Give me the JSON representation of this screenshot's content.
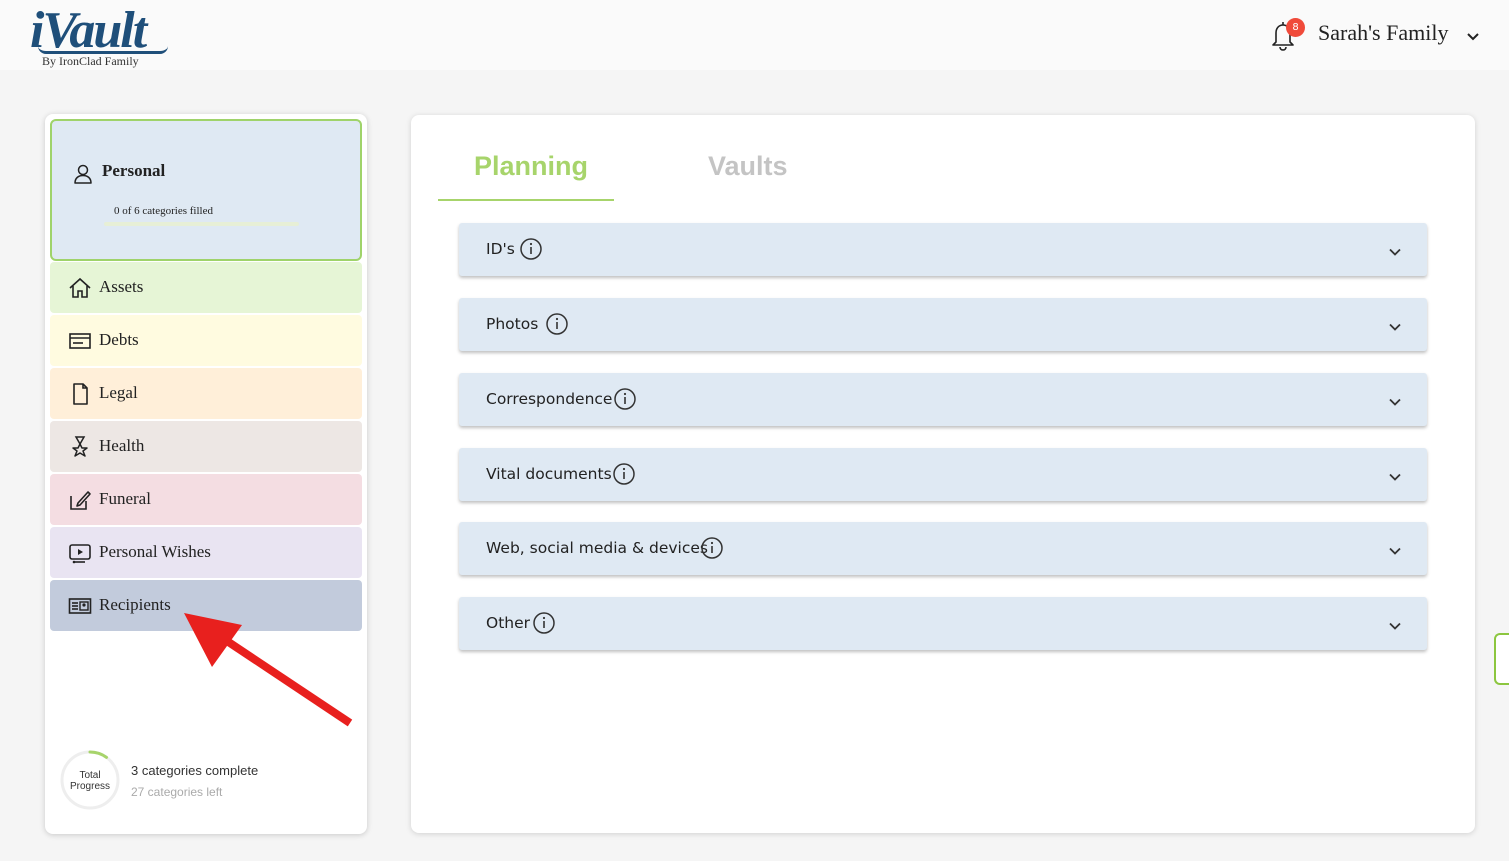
{
  "header": {
    "logo_main": "iVault",
    "logo_sub": "By IronClad Family",
    "notification_count": "8",
    "family_name": "Sarah's Family"
  },
  "sidebar": {
    "personal": {
      "title": "Personal",
      "subtitle": "0 of 6 categories filled",
      "progress": 0
    },
    "items": [
      {
        "label": "Assets",
        "icon": "home-icon",
        "color": "#e6f5d6"
      },
      {
        "label": "Debts",
        "icon": "credit-card-icon",
        "color": "#fffbe0"
      },
      {
        "label": "Legal",
        "icon": "document-icon",
        "color": "#ffefd9"
      },
      {
        "label": "Health",
        "icon": "health-ribbon-icon",
        "color": "#ede7e4"
      },
      {
        "label": "Funeral",
        "icon": "pen-square-icon",
        "color": "#f4dde2"
      },
      {
        "label": "Personal Wishes",
        "icon": "video-icon",
        "color": "#e9e4f2"
      },
      {
        "label": "Recipients",
        "icon": "id-card-icon",
        "color": "#c2cbdc"
      }
    ],
    "total_progress": {
      "label": "Total Progress",
      "complete_text": "3 categories complete",
      "left_text": "27 categories left",
      "fraction": 0.1
    }
  },
  "main": {
    "tabs": [
      {
        "label": "Planning",
        "active": true
      },
      {
        "label": "Vaults",
        "active": false
      }
    ],
    "sections": [
      {
        "label": "ID's"
      },
      {
        "label": "Photos"
      },
      {
        "label": "Correspondence"
      },
      {
        "label": "Vital documents"
      },
      {
        "label": "Web, social media & devices"
      },
      {
        "label": "Other"
      }
    ]
  },
  "colors": {
    "accent_green": "#a7d46b",
    "brand_blue": "#1f4f7a",
    "accordion_bg": "#dfe9f3",
    "annotation_red": "#e8201e"
  }
}
